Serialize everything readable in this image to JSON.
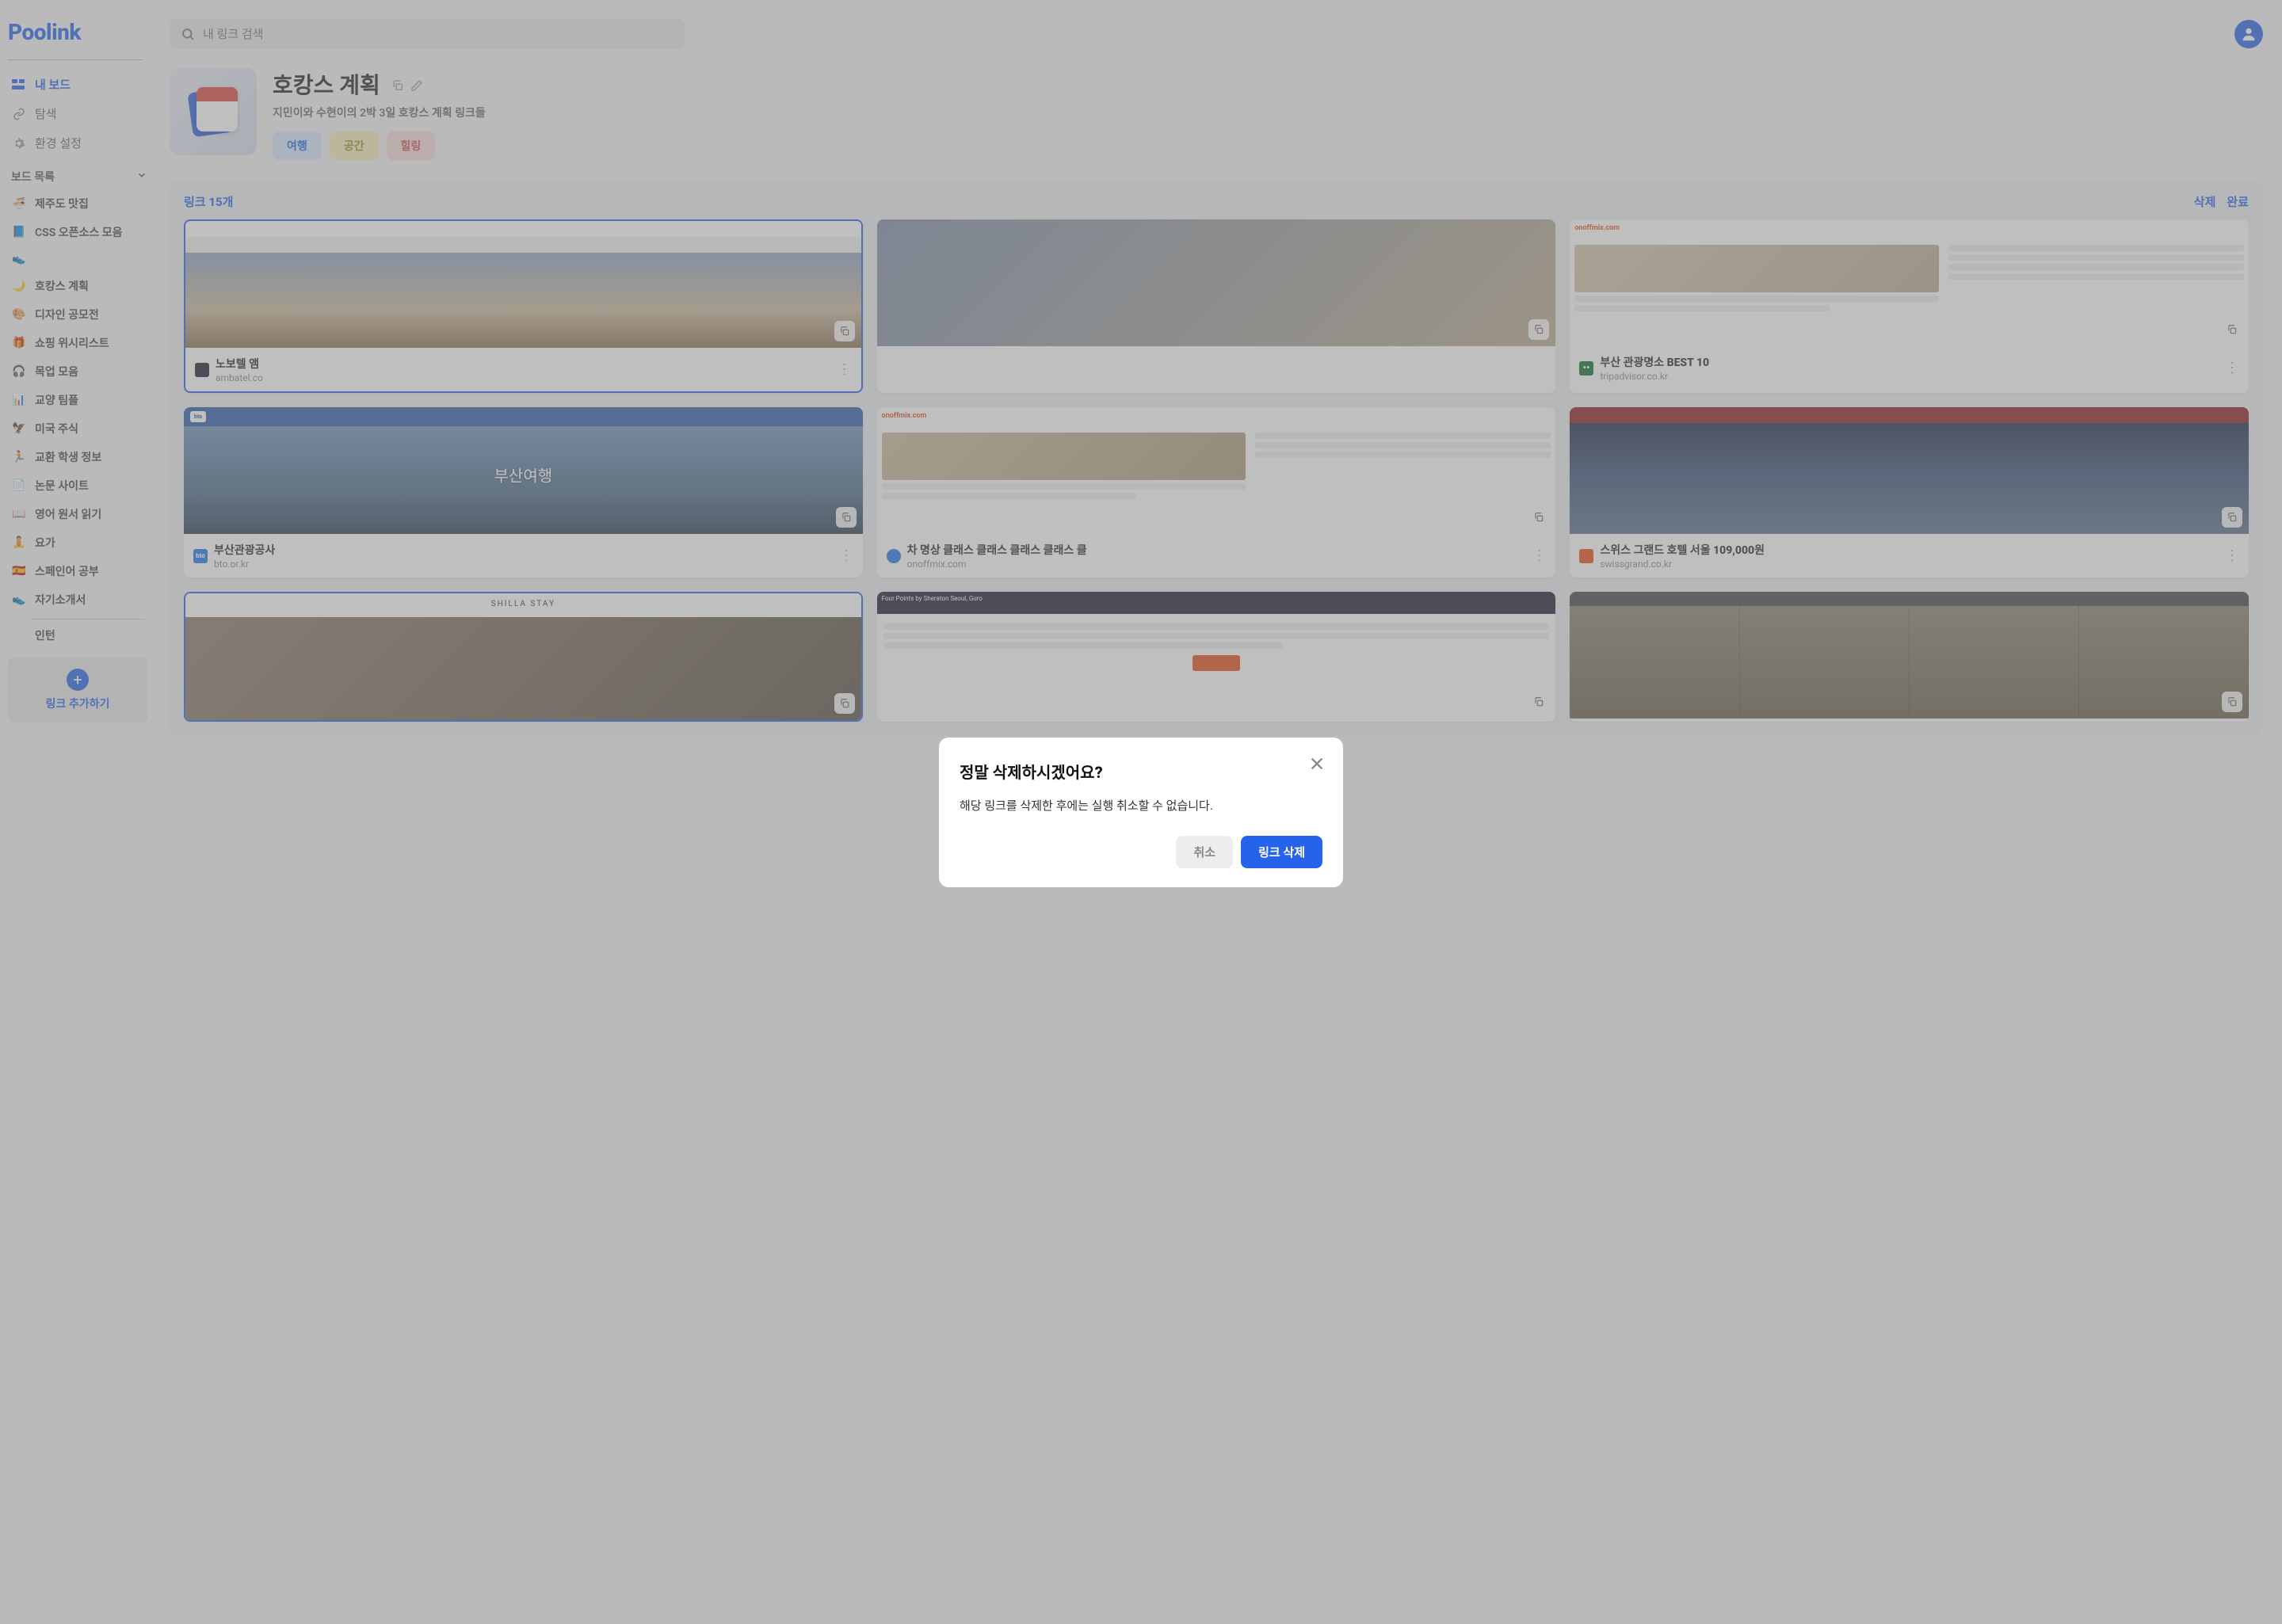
{
  "logo": "Poolink",
  "search": {
    "placeholder": "내 링크 검색"
  },
  "nav": {
    "my_board": "내 보드",
    "explore": "탐색",
    "settings": "환경 설정"
  },
  "board_header": "보드 목록",
  "boards": [
    {
      "emoji": "🍜",
      "label": "제주도 맛집"
    },
    {
      "emoji": "📘",
      "label": "CSS 오픈소스 모음"
    },
    {
      "emoji": "👟",
      "label": ""
    },
    {
      "emoji": "🌙",
      "label": "호캉스 계획"
    },
    {
      "emoji": "🎨",
      "label": "디자인 공모전"
    },
    {
      "emoji": "🎁",
      "label": "쇼핑 위시리스트"
    },
    {
      "emoji": "🎧",
      "label": "목업 모음"
    },
    {
      "emoji": "📊",
      "label": "교양 팀플"
    },
    {
      "emoji": "🦅",
      "label": "미국 주식"
    },
    {
      "emoji": "🏃",
      "label": "교환 학생 정보"
    },
    {
      "emoji": "📄",
      "label": "논문 사이트"
    },
    {
      "emoji": "📖",
      "label": "영어 원서 읽기"
    },
    {
      "emoji": "🧘",
      "label": "요가"
    },
    {
      "emoji": "🇪🇸",
      "label": "스페인어 공부"
    },
    {
      "emoji": "👟",
      "label": "자기소개서"
    },
    {
      "emoji": "",
      "label": "인턴"
    }
  ],
  "add_link": "링크 추가하기",
  "hero": {
    "title": "호캉스 계획",
    "desc": "지민이와 수현이의 2박 3일 호캉스 계획 링크들"
  },
  "tags": {
    "t1": "여행",
    "t2": "공간",
    "t3": "힐링"
  },
  "links_header": {
    "title": "링크 15개",
    "del": "삭제",
    "done": "완료"
  },
  "cards": [
    {
      "title": "노보텔 앰",
      "url": "ambatel.co",
      "thumb": "room",
      "fv": "fv-dark",
      "selected": true
    },
    {
      "title": "",
      "url": "",
      "thumb": "room2",
      "fv": ""
    },
    {
      "title": "부산 관광명소 BEST 10",
      "url": "tripadvisor.co.kr",
      "thumb": "onoff",
      "fv": "fv-green"
    },
    {
      "title": "부산관광공사",
      "url": "bto.or.kr",
      "thumb": "sea",
      "fv": "fv-bto"
    },
    {
      "title": "차 명상 클래스 클래스 클래스 클래스 클",
      "url": "onoffmix.com",
      "thumb": "onoff2",
      "fv": "fv-blue"
    },
    {
      "title": "스위스 그랜드 호텔 서울 109,000원",
      "url": "swissgrand.co.kr",
      "thumb": "city",
      "fv": "fv-orange"
    },
    {
      "title": "",
      "url": "",
      "thumb": "shilla",
      "fv": "",
      "selected": true
    },
    {
      "title": "",
      "url": "",
      "thumb": "fourpoints",
      "fv": ""
    },
    {
      "title": "",
      "url": "",
      "thumb": "heritage",
      "fv": ""
    }
  ],
  "modal": {
    "title": "정말 삭제하시겠어요?",
    "body": "해당 링크를 삭제한 후에는 실행 취소할 수 없습니다.",
    "cancel": "취소",
    "confirm": "링크 삭제"
  },
  "thumb_text": {
    "onoff": "onoffmix.com",
    "sea": "부산여행",
    "shilla": "SHILLA STAY",
    "bto": "bto"
  }
}
